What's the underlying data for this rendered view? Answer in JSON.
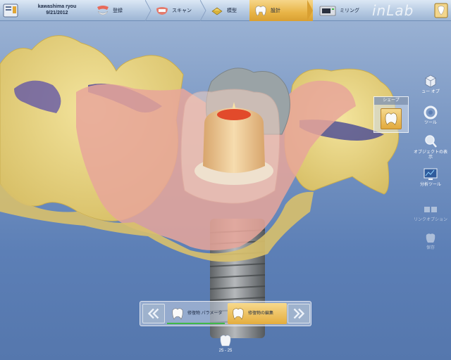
{
  "header": {
    "user_name": "kawashima ryou",
    "date": "9/21/2012",
    "steps": [
      {
        "label": "登録",
        "icon": "scan-jaw-icon"
      },
      {
        "label": "スキャン",
        "icon": "scan-teeth-icon"
      },
      {
        "label": "模型",
        "icon": "model-icon"
      },
      {
        "label": "設計",
        "icon": "design-tooth-icon",
        "active": true
      },
      {
        "label": "ミリング",
        "icon": "milling-machine-icon"
      }
    ],
    "logo": "inLab"
  },
  "tools": {
    "shape_popup_title": "シェープ",
    "object_options": "ュー オプ",
    "tools_label": "ツール",
    "object_display": "オブジェクトの表示",
    "analysis_tools": "分析ツール",
    "link_options": "リンクオプション",
    "save": "保存"
  },
  "workflow": {
    "steps": [
      {
        "label": "修復物 パラメータ"
      },
      {
        "label": "修復物の編集",
        "active": true
      }
    ],
    "counter": "25 - 25"
  },
  "colors": {
    "accent": "#e4ad3e",
    "progress": "#3fb847",
    "gingiva_yellow": "#ecd98a",
    "restoration_pink": "#e8a69a"
  }
}
